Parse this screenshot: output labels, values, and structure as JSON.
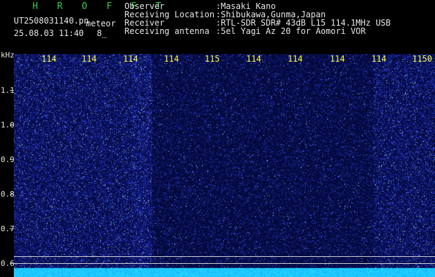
{
  "header": {
    "brand": "H R O F F T",
    "filename": "UT2508031140.pn",
    "tag": "meteor",
    "datetime": "25.08.03 11:40",
    "count": "8_"
  },
  "meta": [
    {
      "key": "Observer",
      "value": ":Masaki Kano"
    },
    {
      "key": "Receiving Location",
      "value": ":Shibukawa,Gunma,Japan"
    },
    {
      "key": "Receiver",
      "value": ":RTL-SDR SDR# 43dB L15 114.1MHz USB"
    },
    {
      "key": "Receiving antenna",
      "value": ":5el Yagi Az 20 for Aomori VOR"
    }
  ],
  "axis": {
    "unit": "kHz",
    "y_labels": [
      "1.1",
      "1.0",
      "0.9",
      "0.8",
      "0.7",
      "0.6"
    ],
    "x_labels": [
      "114",
      "114",
      "114",
      "114",
      "115",
      "114",
      "114",
      "114",
      "114",
      "1150"
    ]
  },
  "colors": {
    "background": "#000000",
    "brand": "#2fd24a",
    "text": "#e8e8e8",
    "freq_label": "#ffff40",
    "signal_band": "#2ab8ff"
  }
}
